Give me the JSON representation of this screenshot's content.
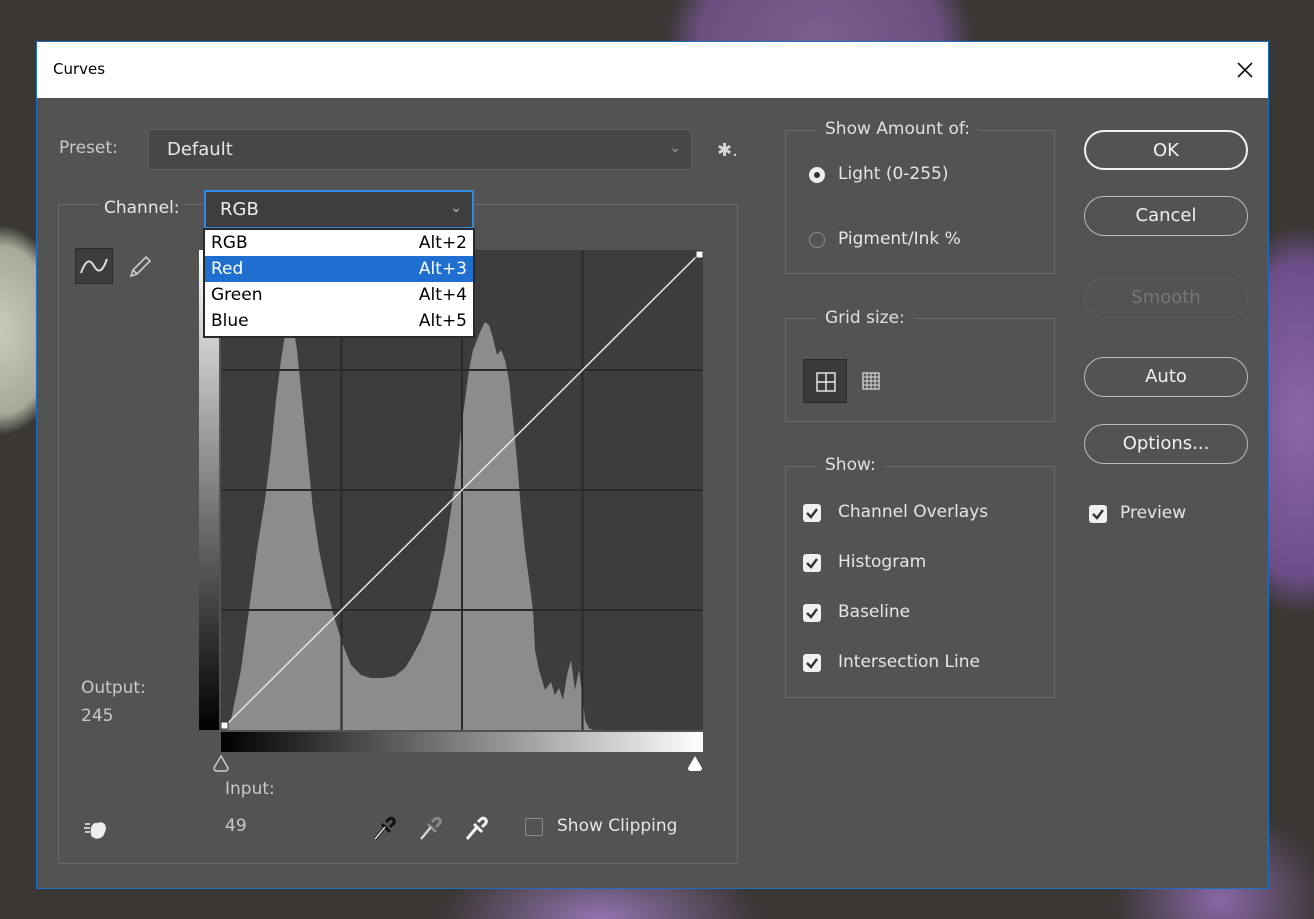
{
  "window": {
    "title": "Curves",
    "close_symbol": "✕"
  },
  "preset": {
    "label": "Preset:",
    "value": "Default",
    "chevron": "⌄",
    "gear": "✱."
  },
  "channel": {
    "label": "Channel:",
    "value": "RGB",
    "chevron": "⌄",
    "options": [
      {
        "label": "RGB",
        "shortcut": "Alt+2"
      },
      {
        "label": "Red",
        "shortcut": "Alt+3",
        "selected": true
      },
      {
        "label": "Green",
        "shortcut": "Alt+4"
      },
      {
        "label": "Blue",
        "shortcut": "Alt+5"
      }
    ]
  },
  "readout": {
    "output_label": "Output:",
    "output_value": "245",
    "input_label": "Input:",
    "input_value": "49"
  },
  "show_clipping": {
    "label": "Show Clipping",
    "checked": false
  },
  "show_amount": {
    "title": "Show Amount of:",
    "light": "Light  (0-255)",
    "pigment": "Pigment/Ink %",
    "selected": "light"
  },
  "grid_size": {
    "title": "Grid size:",
    "selected": "simple"
  },
  "show": {
    "title": "Show:",
    "items": [
      {
        "label": "Channel Overlays",
        "checked": true
      },
      {
        "label": "Histogram",
        "checked": true
      },
      {
        "label": "Baseline",
        "checked": true
      },
      {
        "label": "Intersection Line",
        "checked": true
      }
    ]
  },
  "buttons": {
    "ok": "OK",
    "cancel": "Cancel",
    "smooth": "Smooth",
    "auto": "Auto",
    "options": "Options..."
  },
  "preview": {
    "label": "Preview",
    "checked": true
  },
  "curve": {
    "points": [
      [
        0,
        0
      ],
      [
        255,
        255
      ]
    ]
  },
  "colors": {
    "dialog_bg": "#535353",
    "accent": "#1f6fd1",
    "histogram": "#8c8c8c",
    "graph_bg": "#3d3d3d"
  }
}
